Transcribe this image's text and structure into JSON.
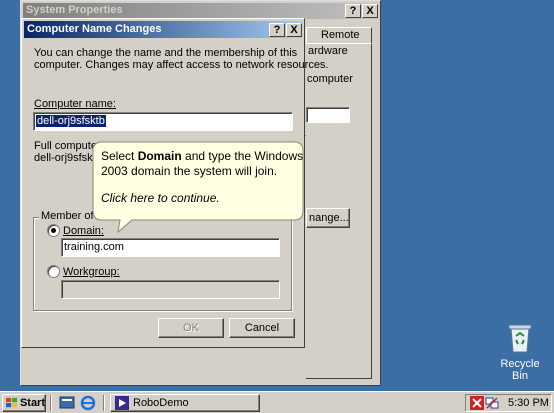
{
  "desktop": {
    "recycle_bin_label": "Recycle Bin"
  },
  "sys_props": {
    "title": "System Properties",
    "help_btn": "?",
    "close_btn": "X",
    "tab_remote": "Remote",
    "tab_hardware": "ardware",
    "label_computer": "computer",
    "label_r": "r",
    "change_btn": "nange..."
  },
  "dialog": {
    "title": "Computer Name Changes",
    "help_btn": "?",
    "close_btn": "X",
    "intro_line1": "You can change the name and the membership of this",
    "intro_line2": "computer. Changes may affect access to network resources.",
    "computer_name_label": "Computer name:",
    "computer_name_value": "dell-orj9sfsktb",
    "full_name_label": "Full computer n",
    "full_name_value": "dell-orj9sfsktb.",
    "member_of_label": "Member of",
    "domain_label": "Domain:",
    "domain_value": "training.com",
    "workgroup_label": "Workgroup:",
    "workgroup_value": "",
    "ok_label": "OK",
    "cancel_label": "Cancel"
  },
  "tooltip": {
    "text_before": "Select ",
    "text_bold": "Domain",
    "text_after": " and type the Windows",
    "line2": "2003 domain the system will join.",
    "line3": "Click here to continue."
  },
  "taskbar": {
    "start_label": "Start",
    "task_label": "RoboDemo",
    "clock": "5:30 PM"
  },
  "colors": {
    "desktop": "#3a6ea5",
    "title_active": "#0a246a",
    "title_inactive": "#808080",
    "tooltip_bg": "#ffffe1"
  }
}
